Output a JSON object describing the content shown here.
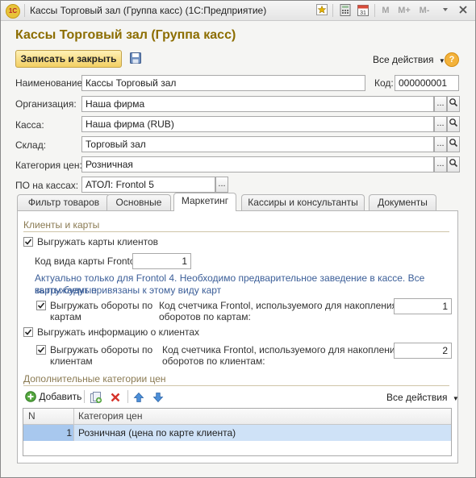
{
  "window": {
    "title": "Кассы Торговый зал (Группа касс)  (1С:Предприятие)",
    "logo_text": "1С",
    "title_buttons": [
      "M",
      "M+",
      "M-"
    ]
  },
  "form": {
    "title": "Кассы Торговый зал (Группа касс)",
    "save_close_label": "Записать и закрыть",
    "all_actions_label": "Все действия",
    "help_label": "?"
  },
  "fields": {
    "name_label": "Наименование:",
    "name_value": "Кассы Торговый зал",
    "code_label": "Код:",
    "code_value": "000000001",
    "org_label": "Организация:",
    "org_value": "Наша фирма",
    "cash_label": "Касса:",
    "cash_value": "Наша фирма (RUB)",
    "warehouse_label": "Склад:",
    "warehouse_value": "Торговый зал",
    "price_cat_label": "Категория цен:",
    "price_cat_value": "Розничная",
    "po_label": "ПО на кассах:",
    "po_value": "АТОЛ: Frontol 5",
    "select_button": "...",
    "open_button": "🔍"
  },
  "tabs": [
    {
      "label": "Фильтр товаров",
      "active": false
    },
    {
      "label": "Основные",
      "active": false
    },
    {
      "label": "Маркетинг",
      "active": true
    },
    {
      "label": "Кассиры и консультанты",
      "active": false
    },
    {
      "label": "Документы",
      "active": false
    }
  ],
  "marketing": {
    "group1_title": "Клиенты и карты",
    "upload_cards_label": "Выгружать карты клиентов",
    "upload_cards_checked": true,
    "card_type_code_label": "Код вида карты Frontol:",
    "card_type_code_value": "1",
    "note_line1": "Актуально только для Frontol 4. Необходимо предварительное заведение в кассе. Все выгружаемые",
    "note_line2": "карты будут привязаны к этому виду карт",
    "turnover_cards_label_1": "Выгружать обороты по",
    "turnover_cards_label_2": "картам",
    "turnover_cards_checked": true,
    "counter_cards_label_1": "Код счетчика Frontol, используемого для накопления",
    "counter_cards_label_2": "оборотов по картам:",
    "counter_cards_value": "1",
    "upload_clients_label": "Выгружать информацию о клиентах",
    "upload_clients_checked": true,
    "turnover_clients_label_1": "Выгружать обороты по",
    "turnover_clients_label_2": "клиентам",
    "turnover_clients_checked": true,
    "counter_clients_label_1": "Код счетчика Frontol, используемого для накопления",
    "counter_clients_label_2": "оборотов по клиентам:",
    "counter_clients_value": "2",
    "group2_title": "Дополнительные категории цен",
    "add_label": "Добавить",
    "all_actions_label": "Все действия",
    "table": {
      "columns": [
        "N",
        "Категория цен"
      ],
      "rows": [
        {
          "n": "1",
          "category": "Розничная (цена по карте клиента)"
        }
      ]
    }
  }
}
